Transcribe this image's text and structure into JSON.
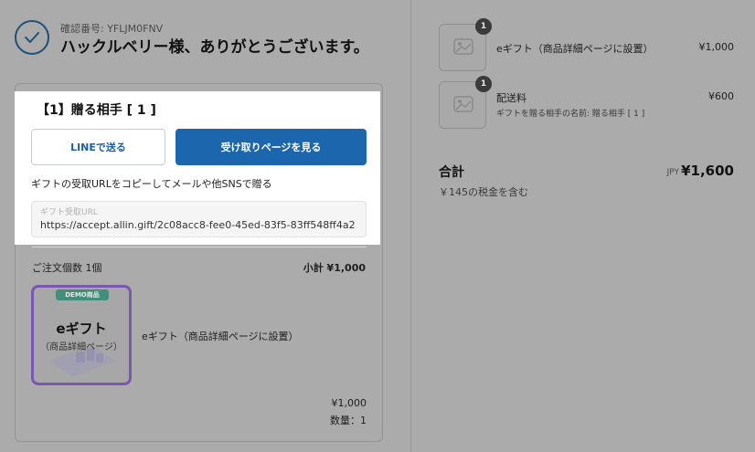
{
  "header": {
    "confirmation_label": "確認番号: YFLJM0FNV",
    "thanks_message": "ハックルベリー様、ありがとうございます。"
  },
  "gift": {
    "recipient_title": "【1】贈る相手 [ 1 ]",
    "line_button": "LINEで送る",
    "receive_button": "受け取りページを見る",
    "copy_instruction": "ギフトの受取URLをコピーしてメールや他SNSで贈る",
    "url_field_label": "ギフト受取URL",
    "url_value": "https://accept.allin.gift/2c08acc8-fee0-45ed-83f5-83ff548ff4a2"
  },
  "order": {
    "quantity_label": "ご注文個数 1個",
    "subtotal": "小計 ¥1,000",
    "product": {
      "badge": "DEMO商品",
      "thumb_title": "eギフト",
      "thumb_sub": "（商品詳細ページ）",
      "name": "eギフト（商品詳細ページに設置）",
      "price": "¥1,000",
      "quantity": "数量：1"
    }
  },
  "summary": {
    "items": [
      {
        "badge": "1",
        "name": "eギフト（商品詳細ページに設置）",
        "price": "¥1,000",
        "note": ""
      },
      {
        "badge": "1",
        "name": "配送料",
        "price": "¥600",
        "note": "ギフトを贈る相手の名前: 贈る相手 [ 1 ]"
      }
    ],
    "total_label": "合計",
    "currency": "JPY",
    "total_amount": "¥1,600",
    "tax_note": "￥145の税金を含む"
  },
  "colors": {
    "primary_button": "#1b66ad",
    "overlay_bg": "#ababab",
    "thumb_border": "#7a56b5",
    "badge_bg": "#3f8f7d"
  }
}
